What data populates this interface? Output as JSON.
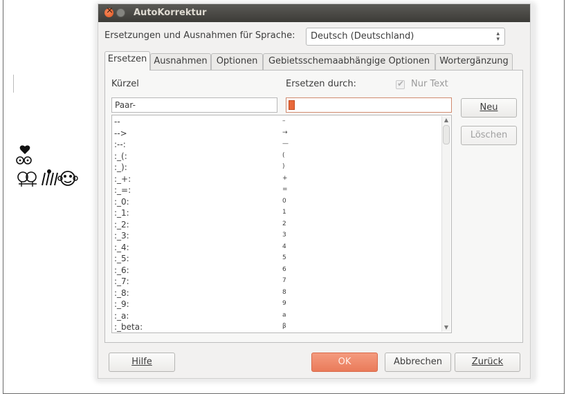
{
  "window": {
    "title": "AutoKorrektur"
  },
  "language": {
    "label": "Ersetzungen und Ausnahmen für Sprache:",
    "selected": "Deutsch (Deutschland)"
  },
  "tabs": [
    {
      "label": "Ersetzen",
      "active": true
    },
    {
      "label": "Ausnahmen",
      "active": false
    },
    {
      "label": "Optionen",
      "active": false
    },
    {
      "label": "Gebietsschemaabhängige Optionen",
      "active": false
    },
    {
      "label": "Wortergänzung",
      "active": false
    }
  ],
  "replace_tab": {
    "short_label": "Kürzel",
    "replace_label": "Ersetzen durch:",
    "text_only_label": "Nur Text",
    "text_only_checked": true,
    "short_value": "Paar-",
    "replace_value": ""
  },
  "entries": [
    {
      "short": "--",
      "replacement": "–"
    },
    {
      "short": "-->",
      "replacement": "→"
    },
    {
      "short": ":--:",
      "replacement": "—"
    },
    {
      "short": ":_(:",
      "replacement": "("
    },
    {
      "short": ":_):",
      "replacement": ")"
    },
    {
      "short": ":_+:",
      "replacement": "+"
    },
    {
      "short": ":_=:",
      "replacement": "="
    },
    {
      "short": ":_0:",
      "replacement": "0"
    },
    {
      "short": ":_1:",
      "replacement": "1"
    },
    {
      "short": ":_2:",
      "replacement": "2"
    },
    {
      "short": ":_3:",
      "replacement": "3"
    },
    {
      "short": ":_4:",
      "replacement": "4"
    },
    {
      "short": ":_5:",
      "replacement": "5"
    },
    {
      "short": ":_6:",
      "replacement": "6"
    },
    {
      "short": ":_7:",
      "replacement": "7"
    },
    {
      "short": ":_8:",
      "replacement": "8"
    },
    {
      "short": ":_9:",
      "replacement": "9"
    },
    {
      "short": ":_a:",
      "replacement": "a"
    },
    {
      "short": ":_beta:",
      "replacement": "β"
    }
  ],
  "side_buttons": {
    "new": "Neu",
    "delete": "Löschen"
  },
  "footer": {
    "help": "Hilfe",
    "ok": "OK",
    "cancel": "Abbrechen",
    "back": "Zurück"
  },
  "colors": {
    "ok_button": "#ea7b5a",
    "titlebar": "#3c3b37",
    "close_button": "#e2531d"
  },
  "icons": [
    "close-icon",
    "minimize-icon",
    "checkmark-icon",
    "spinner-arrows-icon",
    "scroll-up-icon",
    "scroll-down-icon"
  ]
}
